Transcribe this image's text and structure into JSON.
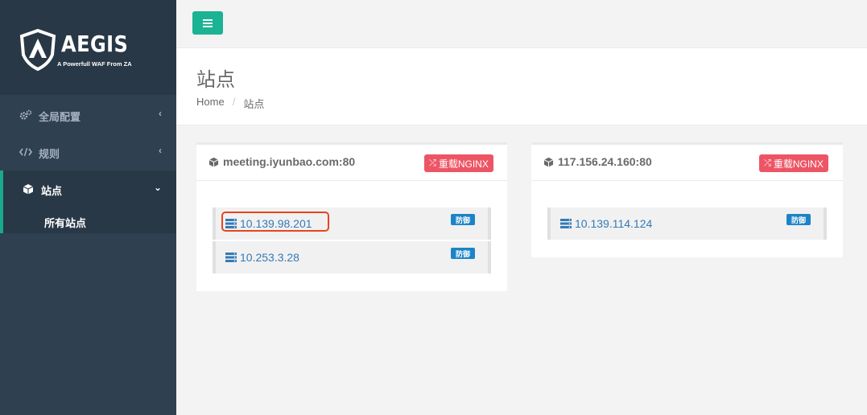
{
  "brand": {
    "name": "AEGIS",
    "tagline": "A Powerfull WAF From ZA"
  },
  "sidebar": {
    "items": [
      {
        "label": "全局配置",
        "icon": "gears-icon"
      },
      {
        "label": "规则",
        "icon": "code-icon"
      },
      {
        "label": "站点",
        "icon": "cube-icon"
      }
    ],
    "subitems": [
      {
        "label": "所有站点"
      }
    ]
  },
  "header": {
    "title": "站点",
    "breadcrumb": {
      "home": "Home",
      "sep": "/",
      "current": "站点"
    }
  },
  "sites": [
    {
      "title": "meeting.iyunbao.com:80",
      "reload_label": "重载NGINX",
      "servers": [
        {
          "ip": "10.139.98.201",
          "badge": "防御"
        },
        {
          "ip": "10.253.3.28",
          "badge": "防御"
        }
      ]
    },
    {
      "title": "117.156.24.160:80",
      "reload_label": "重载NGINX",
      "servers": [
        {
          "ip": "10.139.114.124",
          "badge": "防御"
        }
      ]
    }
  ],
  "colors": {
    "sidebar": "#2f4050",
    "accent": "#1ab394",
    "danger": "#ed5565",
    "badge": "#1c84c6",
    "link": "#337ab7"
  }
}
